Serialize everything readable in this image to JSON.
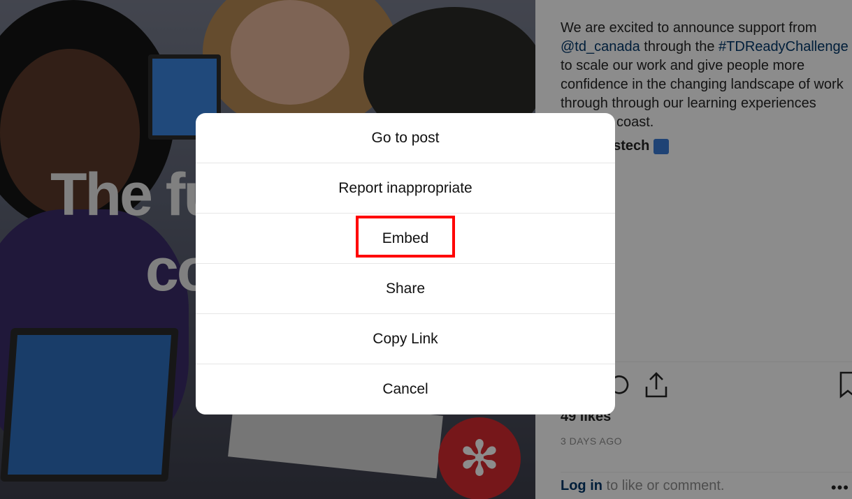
{
  "post": {
    "caption_part1": "We are excited to announce support from ",
    "mention": "@td_canada",
    "caption_part2": " through the ",
    "hashtag": "#TDReadyChallenge",
    "caption_part3": " to scale our work and give people more confidence in the changing landscape of work through through our learning experiences",
    "caption_part4": "coast.",
    "author": "lwstech",
    "likes": "49 likes",
    "date": "3 DAYS AGO",
    "login_link": "Log in",
    "login_text": " to like or comment.",
    "more": "•••"
  },
  "photo": {
    "overlay_text_1": "The fu",
    "overlay_text_2": "co"
  },
  "menu": {
    "items": [
      {
        "label": "Go to post"
      },
      {
        "label": "Report inappropriate"
      },
      {
        "label": "Embed"
      },
      {
        "label": "Share"
      },
      {
        "label": "Copy Link"
      },
      {
        "label": "Cancel"
      }
    ]
  },
  "colors": {
    "highlight": "#ff0000",
    "link": "#00376b",
    "badge": "#d72b30"
  }
}
